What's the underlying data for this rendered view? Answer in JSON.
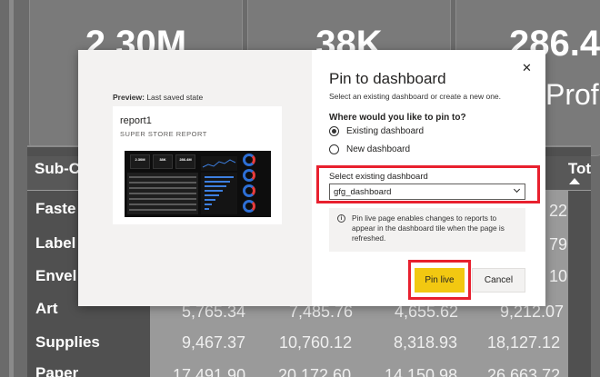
{
  "report": {
    "kpis": [
      {
        "value": "2.30M",
        "label": ""
      },
      {
        "value": "38K",
        "label": ""
      },
      {
        "value": "286.4",
        "label": "Profi"
      }
    ],
    "table": {
      "col_header": "Sub-C",
      "col_header_right": "Tot",
      "rows": [
        {
          "label": "Faste",
          "cells": [
            "",
            "",
            "",
            "22"
          ]
        },
        {
          "label": "Label",
          "cells": [
            "",
            "",
            "",
            "79"
          ]
        },
        {
          "label": "Envel",
          "cells": [
            "",
            "",
            "",
            "10"
          ]
        },
        {
          "label": "Art",
          "cells": [
            "5,765.34",
            "7,485.76",
            "4,655.62",
            "9,212.07"
          ]
        },
        {
          "label": "Supplies",
          "cells": [
            "9,467.37",
            "10,760.12",
            "8,318.93",
            "18,127.12"
          ]
        },
        {
          "label": "Paper",
          "cells": [
            "17,491.90",
            "20,172.60",
            "14,150.98",
            "26,663.72"
          ]
        }
      ]
    }
  },
  "dialog": {
    "preview_label_bold": "Preview:",
    "preview_label_rest": " Last saved state",
    "card_title": "report1",
    "card_subtitle": "SUPER STORE REPORT",
    "thumb_kpis": [
      "2.30M",
      "38K",
      "286.4M"
    ],
    "title": "Pin to dashboard",
    "subtitle": "Select an existing dashboard or create a new one.",
    "close_glyph": "✕",
    "question": "Where would you like to pin to?",
    "options": [
      {
        "label": "Existing dashboard",
        "checked": true
      },
      {
        "label": "New dashboard",
        "checked": false
      }
    ],
    "select_label": "Select existing dashboard",
    "select_value": "gfg_dashboard",
    "info_icon": "i",
    "info_text": "Pin live page enables changes to reports to appear in the dashboard tile when the page is refreshed.",
    "pin_label": "Pin live",
    "cancel_label": "Cancel"
  },
  "colors": {
    "accent_yellow": "#f2c811",
    "highlight_red": "#e8202e"
  }
}
